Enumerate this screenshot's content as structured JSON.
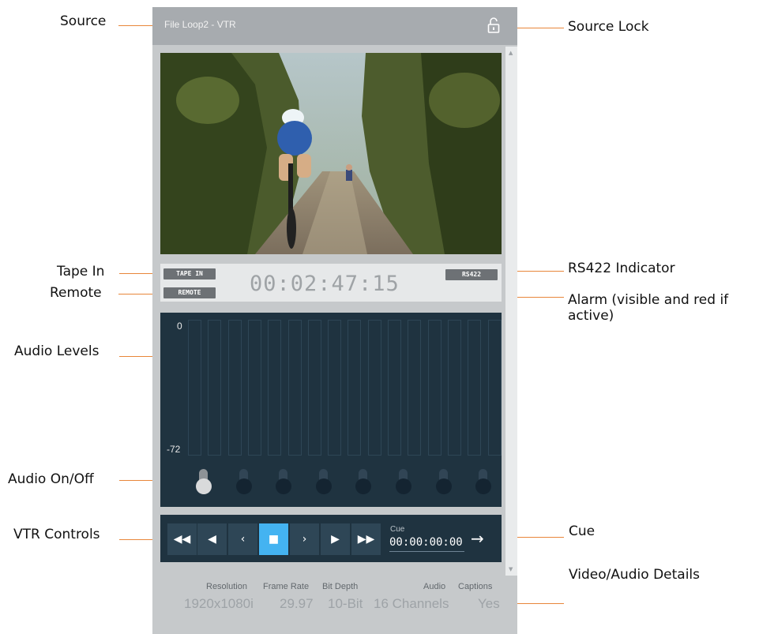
{
  "panel": {
    "source_title": "File Loop2 - VTR",
    "tape_in": "TAPE IN",
    "remote": "REMOTE",
    "rs422": "RS422",
    "timecode": "00:02:47:15"
  },
  "audio": {
    "top_label": "0",
    "bottom_label": "-72",
    "meter_count": 16,
    "toggles": [
      true,
      false,
      false,
      false,
      false,
      false,
      false,
      false
    ]
  },
  "vtr": {
    "buttons": [
      "rewind",
      "play-reverse",
      "step-back",
      "stop",
      "step-forward",
      "play",
      "fast-forward"
    ],
    "active": "stop",
    "cue_label": "Cue",
    "cue_time": "00:00:00:00"
  },
  "details": {
    "resolution_label": "Resolution",
    "resolution": "1920x1080i",
    "frame_rate_label": "Frame Rate",
    "frame_rate": "29.97",
    "bit_depth_label": "Bit Depth",
    "bit_depth": "10-Bit",
    "audio_label": "Audio",
    "audio": "16 Channels",
    "captions_label": "Captions",
    "captions": "Yes"
  },
  "callouts": {
    "source": "Source",
    "source_lock": "Source Lock",
    "tape_in": "Tape In",
    "remote": "Remote",
    "rs422": "RS422 Indicator",
    "alarm": "Alarm (visible and red if active)",
    "audio_levels": "Audio Levels",
    "audio_onoff": "Audio On/Off",
    "vtr_controls": "VTR Controls",
    "cue": "Cue",
    "details": "Video/Audio Details"
  },
  "colors": {
    "header_bg": "#a7abaf",
    "panel_bg": "#c6c9cb",
    "audio_bg": "#1f3340",
    "accent_blue": "#44b3f1",
    "callout_line": "#e8863a"
  }
}
